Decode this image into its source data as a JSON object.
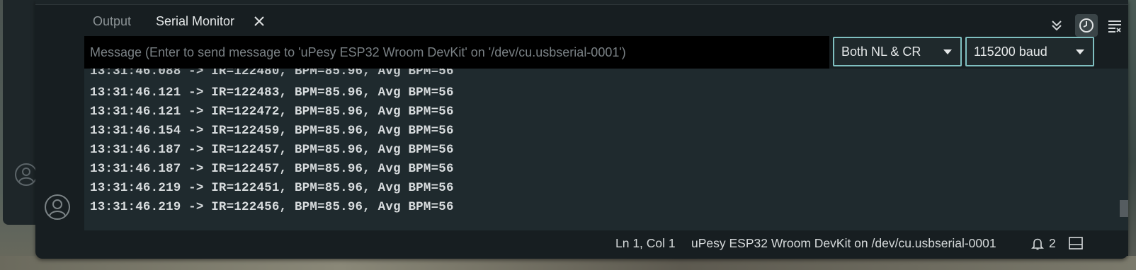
{
  "tabs": [
    {
      "label": "Output",
      "active": false
    },
    {
      "label": "Serial Monitor",
      "active": true
    }
  ],
  "header_icons": [
    "chevrons-down-icon",
    "clock-icon",
    "clear-output-icon"
  ],
  "message": {
    "value": "",
    "placeholder": "Message (Enter to send message to 'uPesy ESP32 Wroom DevKit' on '/dev/cu.usbserial-0001')"
  },
  "line_ending": {
    "selected": "Both NL & CR"
  },
  "baud_rate": {
    "selected": "115200 baud"
  },
  "log": {
    "partial_line": "13:31:46.088 -> IR=122480, BPM=85.96, Avg BPM=56",
    "lines": [
      "13:31:46.121 -> IR=122483, BPM=85.96, Avg BPM=56",
      "13:31:46.121 -> IR=122472, BPM=85.96, Avg BPM=56",
      "13:31:46.154 -> IR=122459, BPM=85.96, Avg BPM=56",
      "13:31:46.187 -> IR=122457, BPM=85.96, Avg BPM=56",
      "13:31:46.187 -> IR=122457, BPM=85.96, Avg BPM=56",
      "13:31:46.219 -> IR=122451, BPM=85.96, Avg BPM=56",
      "13:31:46.219 -> IR=122456, BPM=85.96, Avg BPM=56"
    ]
  },
  "status": {
    "cursor": "Ln 1, Col 1",
    "board": "uPesy ESP32 Wroom DevKit on /dev/cu.usbserial-0001",
    "notifications": "2"
  },
  "colors": {
    "panel_bg": "#1f2a2e",
    "accent_border": "#7fbfc0",
    "text": "#d8dcde"
  }
}
